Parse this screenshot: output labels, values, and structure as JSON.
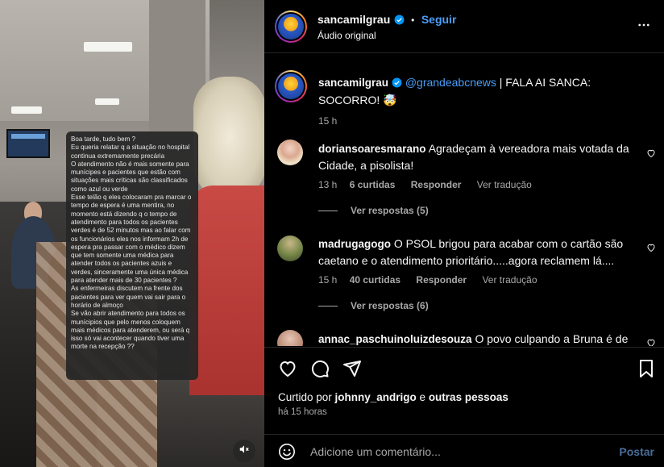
{
  "media": {
    "overlay_text": "Boa tarde, tudo bem ?\nEu queria relatar q a situação no hospital continua extremamente precária\nO atendimento não é mais somente para munícipes e pacientes que estão com situações mais críticas são classificados como azul ou verde\nEsse telão q eles colocaram pra marcar o tempo de espera é uma mentira, no momento está dizendo q o tempo de atendimento para todos os pacientes verdes é de 52 minutos mas ao falar com os funcionários eles nos informam 2h de espera pra passar com o médico dizem que tem somente uma médica para atender todos os pacientes azuis e verdes, sinceramente uma única médica para atender mais de 30 pacientes ?\nAs enfermeiras discutem na frente dos pacientes para ver quem vai sair para o horário de almoço\nSe vão abrir atendimento para todos os munícipios que pelo menos coloquem mais médicos para atenderem, ou será q isso só vai acontecer quando tiver uma morte na recepção ??",
    "mute_icon": "speaker-muted-icon"
  },
  "header": {
    "username": "sancamilgrau",
    "separator": "•",
    "follow_label": "Seguir",
    "audio_label": "Áudio original",
    "more_icon": "more-horizontal-icon"
  },
  "caption": {
    "username": "sancamilgrau",
    "mention": "@grandeabcnews",
    "text": " | FALA AI SANCA: SOCORRO! 🤯",
    "time": "15 h"
  },
  "comments": [
    {
      "username": "doriansoaresmarano",
      "text": "Agradeçam à vereadora mais votada da Cidade, a pisolista!",
      "time": "13 h",
      "likes": "6 curtidas",
      "reply_label": "Responder",
      "translate_label": "Ver tradução",
      "view_replies": "Ver respostas (5)"
    },
    {
      "username": "madrugagogo",
      "text": "O PSOL brigou para acabar com o cartão são caetano e o atendimento prioritário.....agora reclamem lá....",
      "time": "15 h",
      "likes": "40 curtidas",
      "reply_label": "Responder",
      "translate_label": "Ver tradução",
      "view_replies": "Ver respostas (6)"
    },
    {
      "username": "annac_paschuinoluizdesouza",
      "text": "O povo culpando a Bruna é de"
    }
  ],
  "footer": {
    "liked_by_prefix": "Curtido por ",
    "liked_by_user": "johnny_andrigo",
    "liked_by_middle": " e ",
    "liked_by_others": "outras pessoas",
    "date": "há 15 horas",
    "comment_placeholder": "Adicione um comentário...",
    "post_label": "Postar"
  },
  "colors": {
    "accent": "#4a9df8",
    "muted": "#a8a8a8",
    "post_disabled": "#4a6e9a"
  }
}
